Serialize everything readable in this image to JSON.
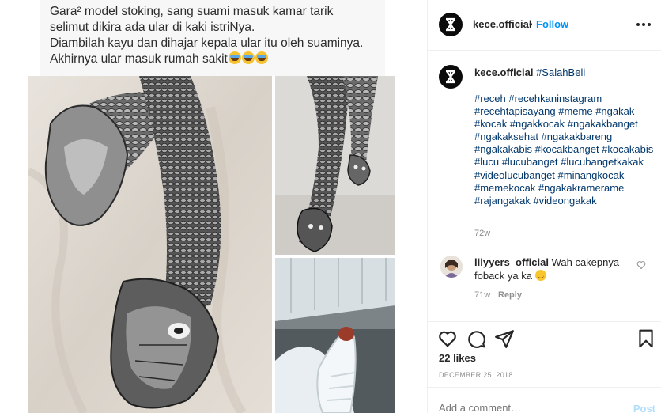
{
  "caption_image": {
    "lines": [
      "Gara² model stoking, sang suami masuk kamar tarik",
      "selimut dikira ada ular di kaki istriNya.",
      "Diambilah kayu dan dihajar kepala ular itu oleh suaminya.",
      "Akhirnya ular masuk rumah sakit"
    ],
    "emoji_count": 3
  },
  "header": {
    "username": "kece.official",
    "separator": "•",
    "follow_label": "Follow"
  },
  "post_caption": {
    "username": "kece.official",
    "first_tag": "#SalahBeli",
    "hashtags": "#receh #recehkaninstagram #recehtapisayang #meme #ngakak #kocak #ngakkocak #ngakakbanget #ngakaksehat #ngakakbareng #ngakakabis #kocakbanget #kocakabis #lucu #lucubanget #lucubangetkakak #videolucubanget #minangkocak #memekocak #ngakakramerame #rajangakak #videongakak",
    "time": "72w"
  },
  "comment": {
    "username": "lilyyers_official",
    "text": "Wah cakepnya foback ya ka",
    "time": "71w",
    "reply_label": "Reply"
  },
  "actions": {
    "icons": [
      "heart-icon",
      "comment-icon",
      "share-icon",
      "bookmark-icon"
    ]
  },
  "likes": "22 likes",
  "date": "DECEMBER 25, 2018",
  "add_comment": {
    "placeholder": "Add a comment…",
    "post_label": "Post"
  },
  "colors": {
    "link": "#00376b",
    "follow": "#0095f6",
    "muted": "#8e8e8e",
    "post_disabled": "#b2dffc"
  }
}
